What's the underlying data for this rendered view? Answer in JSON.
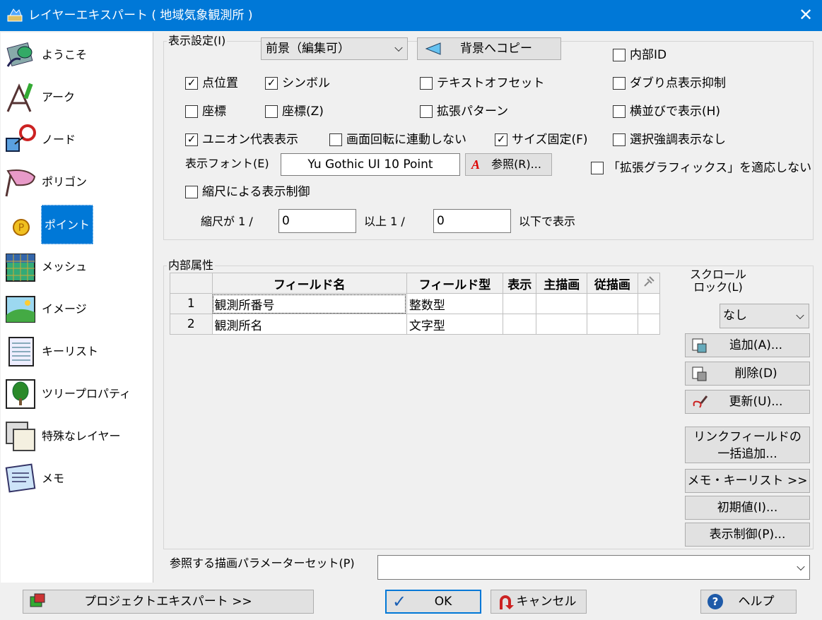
{
  "window": {
    "title": "レイヤーエキスパート ( 地域気象観測所 )",
    "close_glyph": "✕"
  },
  "sidebar": {
    "items": [
      {
        "label": "ようこそ",
        "icon": "welcome-icon"
      },
      {
        "label": "アーク",
        "icon": "arc-icon"
      },
      {
        "label": "ノード",
        "icon": "node-icon"
      },
      {
        "label": "ポリゴン",
        "icon": "polygon-icon"
      },
      {
        "label": "ポイント",
        "icon": "point-icon",
        "selected": true
      },
      {
        "label": "メッシュ",
        "icon": "mesh-icon"
      },
      {
        "label": "イメージ",
        "icon": "image-icon"
      },
      {
        "label": "キーリスト",
        "icon": "keylist-icon"
      },
      {
        "label": "ツリープロパティ",
        "icon": "tree-icon"
      },
      {
        "label": "特殊なレイヤー",
        "icon": "special-layer-icon"
      },
      {
        "label": "メモ",
        "icon": "memo-icon"
      }
    ]
  },
  "display": {
    "group_title": "表示設定(I)",
    "layer_select": "前景（編集可）",
    "copy_button": "背景へコピー",
    "checkboxes": {
      "point_pos": {
        "label": "点位置",
        "checked": true
      },
      "symbol": {
        "label": "シンボル",
        "checked": true
      },
      "text_offset": {
        "label": "テキストオフセット",
        "checked": false
      },
      "internal_id": {
        "label": "内部ID",
        "checked": false
      },
      "dup_suppress": {
        "label": "ダブり点表示抑制",
        "checked": false
      },
      "coord": {
        "label": "座標",
        "checked": false
      },
      "coord_z": {
        "label": "座標(Z)",
        "checked": false
      },
      "ext_pattern": {
        "label": "拡張パターン",
        "checked": false
      },
      "horizontal": {
        "label": "横並びで表示(H)",
        "checked": false
      },
      "union_rep": {
        "label": "ユニオン代表表示",
        "checked": true
      },
      "no_rotate": {
        "label": "画面回転に連動しない",
        "checked": false
      },
      "fixed_size": {
        "label": "サイズ固定(F)",
        "checked": true
      },
      "no_highlight": {
        "label": "選択強調表示なし",
        "checked": false
      },
      "no_ext_graphics": {
        "label": "「拡張グラフィックス」を適応しない",
        "checked": false
      },
      "scale_control": {
        "label": "縮尺による表示制御",
        "checked": false
      }
    },
    "font_label": "表示フォント(E)",
    "font_value": "Yu Gothic UI 10 Point",
    "browse_button": "参照(R)...",
    "scale_prefix": "縮尺が 1 /",
    "scale_min": "0",
    "scale_mid": "以上 1 /",
    "scale_max": "0",
    "scale_suffix": "以下で表示"
  },
  "attributes": {
    "group_title": "内部属性",
    "columns": [
      "",
      "フィールド名",
      "フィールド型",
      "表示",
      "主描画",
      "従描画",
      "pin-icon"
    ],
    "rows": [
      {
        "num": "1",
        "name": "観測所番号",
        "type": "整数型"
      },
      {
        "num": "2",
        "name": "観測所名",
        "type": "文字型"
      }
    ],
    "scroll_lock_label": "スクロール\nロック(L)",
    "scroll_lock_value": "なし",
    "add_button": "追加(A)...",
    "delete_button": "削除(D)",
    "update_button": "更新(U)...",
    "link_add_button": "リンクフィールドの\n一括追加...",
    "memo_keylist_button": "メモ・キーリスト >>",
    "initial_button": "初期値(I)...",
    "display_ctrl_button": "表示制御(P)..."
  },
  "param_set": {
    "label": "参照する描画パラメーターセット(P)",
    "value": ""
  },
  "footer": {
    "project_button": "プロジェクトエキスパート >>",
    "ok_button": "OK",
    "cancel_button": "キャンセル",
    "help_button": "ヘルプ"
  }
}
